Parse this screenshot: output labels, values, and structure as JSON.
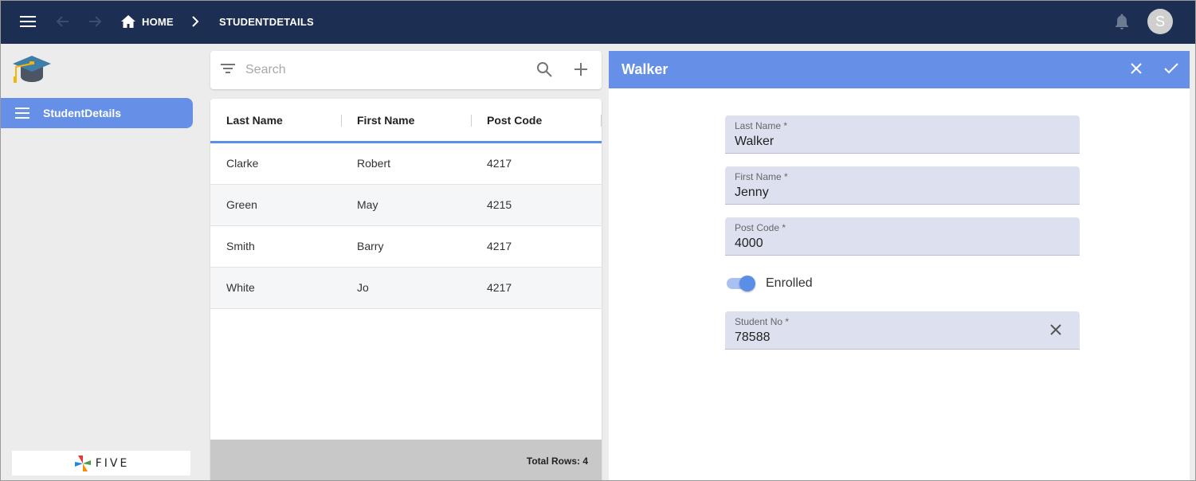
{
  "topbar": {
    "home_label": "HOME",
    "current_label": "STUDENTDETAILS",
    "avatar_initial": "S",
    "icons": [
      "menu-icon",
      "arrow-left-icon",
      "arrow-right-icon",
      "home-icon",
      "chevron-right-icon",
      "bell-icon"
    ]
  },
  "sidebar": {
    "items": [
      {
        "label": "StudentDetails",
        "icon": "menu-icon",
        "selected": true
      }
    ],
    "brand_word": "FIVE"
  },
  "list": {
    "search_placeholder": "Search",
    "columns": [
      "Last Name",
      "First Name",
      "Post Code"
    ],
    "rows": [
      [
        "Clarke",
        "Robert",
        "4217"
      ],
      [
        "Green",
        "May",
        "4215"
      ],
      [
        "Smith",
        "Barry",
        "4217"
      ],
      [
        "White",
        "Jo",
        "4217"
      ]
    ],
    "total_label": "Total Rows: 4"
  },
  "detail": {
    "title": "Walker",
    "fields": [
      {
        "label": "Last Name *",
        "value": "Walker"
      },
      {
        "label": "First Name *",
        "value": "Jenny"
      },
      {
        "label": "Post Code *",
        "value": "4000"
      }
    ],
    "toggle": {
      "label": "Enrolled",
      "checked": true
    },
    "student_no": {
      "label": "Student No *",
      "value": "78588"
    }
  },
  "colors": {
    "topbar": "#1c2e52",
    "accent": "#6690e8",
    "field_bg": "#dde1ef",
    "footer": "#c8c8c8"
  }
}
